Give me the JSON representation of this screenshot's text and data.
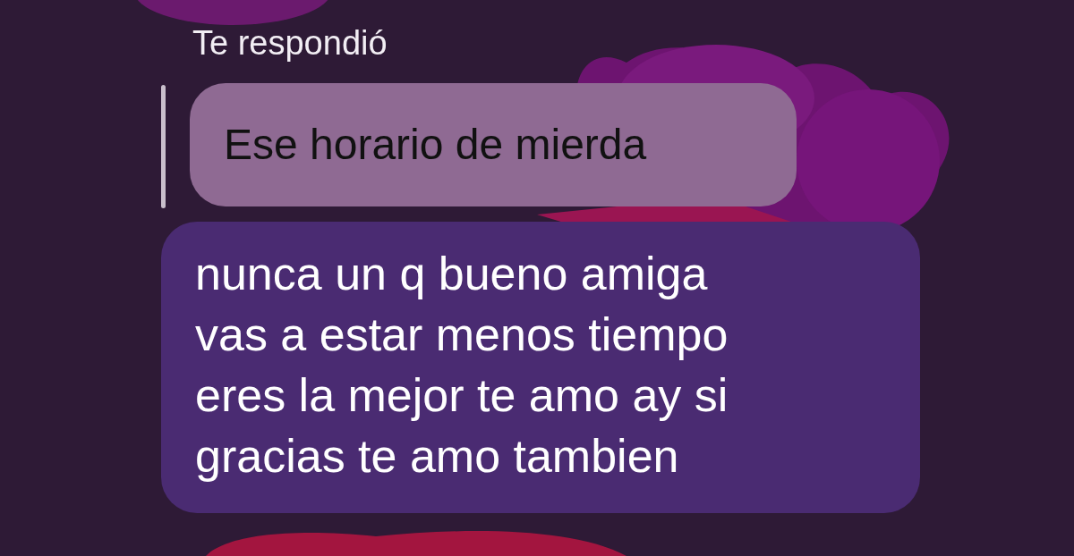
{
  "reply_label": "Te respondió",
  "quoted_message": {
    "text": "Ese horario de mierda"
  },
  "message": {
    "text": "nunca un q bueno amiga\nvas a estar menos tiempo\neres la mejor te amo ay si\ngracias te amo tambien"
  }
}
